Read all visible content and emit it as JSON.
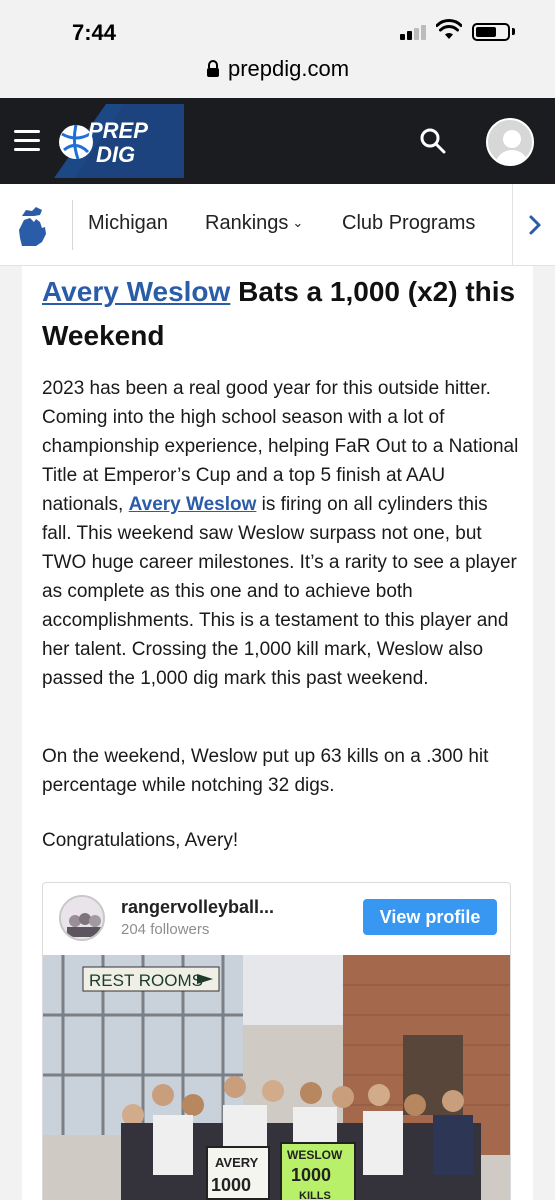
{
  "status_bar": {
    "time": "7:44"
  },
  "browser": {
    "url": "prepdig.com"
  },
  "header": {
    "logo_line1": "PREP",
    "logo_line2": "DIG"
  },
  "subnav": {
    "items": [
      {
        "label": "Michigan"
      },
      {
        "label": "Rankings"
      },
      {
        "label": "Club Programs"
      }
    ]
  },
  "article": {
    "title_link": "Avery Weslow",
    "title_rest": " Bats a 1,000 (x2) this Weekend",
    "p1_before": "2023 has been a real good year for this outside hitter. Coming into the high school season with a lot of championship experience, helping FaR Out to a National Title at Emperor’s Cup and a top 5 finish at AAU nationals, ",
    "p1_link": "Avery Weslow",
    "p1_after": " is firing on all cylinders this fall. This weekend saw Weslow surpass not one, but TWO huge career milestones. It’s a rarity to see a player as complete as this one and to achieve both accomplishments. This is a testament to this player and her talent. Crossing the 1,000 kill mark, Weslow also passed the 1,000 dig mark this past weekend.",
    "p2": "On the weekend, Weslow put up 63 kills on a .300 hit percentage while notching 32 digs.",
    "p3": "Congratulations, Avery!"
  },
  "instagram": {
    "account": "rangervolleyball...",
    "followers": "204 followers",
    "button": "View profile",
    "photo": {
      "sign": "REST ROOMS",
      "poster_left_name": "AVERY",
      "poster_left_num": "1000",
      "poster_right_name": "WESLOW",
      "poster_right_num": "1000",
      "poster_right_sub": "KILLS"
    }
  },
  "colors": {
    "header_bg": "#1b1c1f",
    "logo_blue": "#1e6fd9",
    "link": "#2a5ca8",
    "ig_button": "#3897f0"
  }
}
